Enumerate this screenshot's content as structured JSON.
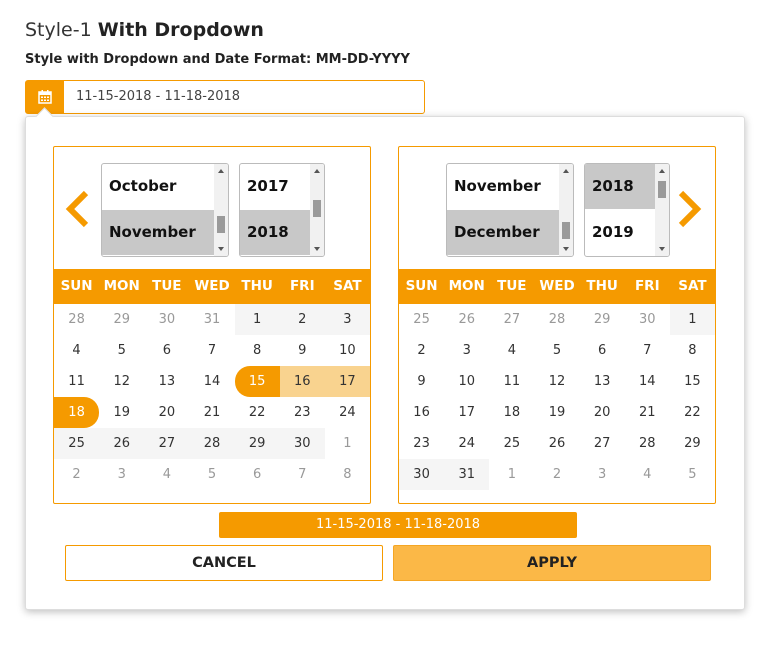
{
  "header": {
    "title_prefix": "Style-1 ",
    "title_bold": "With Dropdown",
    "subtitle": "Style with Dropdown and Date Format: MM-DD-YYYY"
  },
  "input": {
    "value": "11-15-2018 - 11-18-2018",
    "icon": "calendar-icon"
  },
  "weekdays": [
    "SUN",
    "MON",
    "TUE",
    "WED",
    "THU",
    "FRI",
    "SAT"
  ],
  "left_calendar": {
    "months_visible": [
      "October",
      "November"
    ],
    "selected_month": "November",
    "years_visible": [
      "2017",
      "2018"
    ],
    "selected_year": "2018",
    "nav_icon": "chevron-left-icon",
    "weeks": [
      [
        "28",
        "29",
        "30",
        "31",
        "1",
        "2",
        "3"
      ],
      [
        "4",
        "5",
        "6",
        "7",
        "8",
        "9",
        "10"
      ],
      [
        "11",
        "12",
        "13",
        "14",
        "15",
        "16",
        "17"
      ],
      [
        "18",
        "19",
        "20",
        "21",
        "22",
        "23",
        "24"
      ],
      [
        "25",
        "26",
        "27",
        "28",
        "29",
        "30",
        "1"
      ],
      [
        "2",
        "3",
        "4",
        "5",
        "6",
        "7",
        "8"
      ]
    ]
  },
  "right_calendar": {
    "months_visible": [
      "November",
      "December"
    ],
    "selected_month": "December",
    "years_visible": [
      "2018",
      "2019"
    ],
    "selected_year": "2018",
    "nav_icon": "chevron-right-icon",
    "weeks": [
      [
        "25",
        "26",
        "27",
        "28",
        "29",
        "30",
        "1"
      ],
      [
        "2",
        "3",
        "4",
        "5",
        "6",
        "7",
        "8"
      ],
      [
        "9",
        "10",
        "11",
        "12",
        "13",
        "14",
        "15"
      ],
      [
        "16",
        "17",
        "18",
        "19",
        "20",
        "21",
        "22"
      ],
      [
        "23",
        "24",
        "25",
        "26",
        "27",
        "28",
        "29"
      ],
      [
        "30",
        "31",
        "1",
        "2",
        "3",
        "4",
        "5"
      ]
    ]
  },
  "range_display": "11-15-2018 - 11-18-2018",
  "buttons": {
    "cancel": "CANCEL",
    "apply": "APPLY"
  },
  "colors": {
    "accent": "#f59a00",
    "range": "#f9d38f",
    "apply_bg": "#fbb847"
  }
}
